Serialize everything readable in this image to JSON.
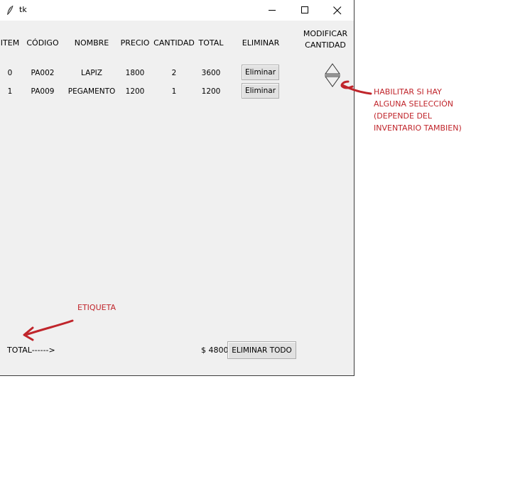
{
  "window": {
    "title": "tk",
    "icon": "feather-icon",
    "controls": [
      "minimize-icon",
      "maximize-icon",
      "close-icon"
    ]
  },
  "table": {
    "headers": {
      "item": "ITEM",
      "codigo": "CÓDIGO",
      "nombre": "NOMBRE",
      "precio": "PRECIO",
      "cantidad": "CANTIDAD",
      "total": "TOTAL",
      "eliminar": "ELIMINAR",
      "modificar_line1": "MODIFICAR",
      "modificar_line2": "CANTIDAD"
    },
    "rows": [
      {
        "item": "0",
        "codigo": "PA002",
        "nombre": "LAPIZ",
        "precio": "1800",
        "cantidad": "2",
        "total": "3600",
        "button": "Eliminar"
      },
      {
        "item": "1",
        "codigo": "PA009",
        "nombre": "PEGAMENTO",
        "precio": "1200",
        "cantidad": "1",
        "total": "1200",
        "button": "Eliminar"
      }
    ],
    "spinner": {
      "up_icon": "triangle-up-icon",
      "down_icon": "triangle-down-icon"
    }
  },
  "footer": {
    "total_label": "TOTAL------>",
    "total_value": "$ 4800",
    "clear_all_button": "ELIMINAR TODO"
  },
  "annotations": {
    "color": "#c0252b",
    "etiqueta": "ETIQUETA",
    "spinner_note_lines": [
      "HABILITAR SI HAY",
      "ALGUNA SELECCIÓN",
      "(DEPENDE DEL",
      "INVENTARIO TAMBIEN)"
    ]
  }
}
